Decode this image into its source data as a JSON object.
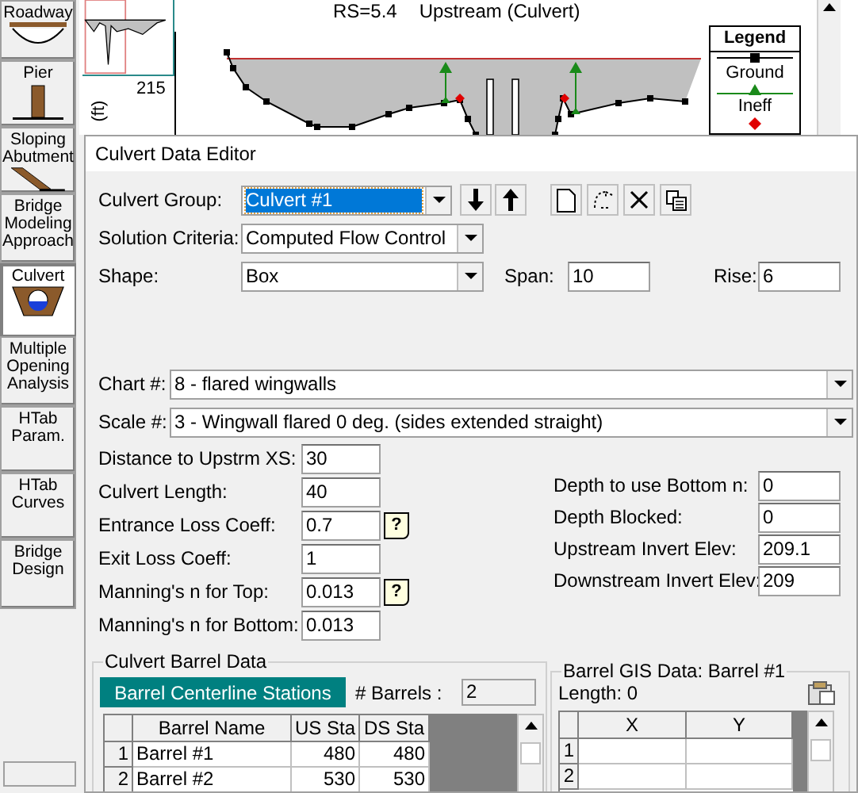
{
  "tool_buttons": [
    {
      "label": "Roadway",
      "kind": "roadway",
      "selected": false
    },
    {
      "label": "Pier",
      "kind": "pier",
      "selected": false
    },
    {
      "label": "Sloping Abutment",
      "kind": "abutment",
      "selected": false
    },
    {
      "label": "Bridge Modeling Approach",
      "kind": "text",
      "selected": false
    },
    {
      "label": "Culvert",
      "kind": "culvert",
      "selected": true
    },
    {
      "label": "Multiple Opening Analysis",
      "kind": "text",
      "selected": false
    },
    {
      "label": "HTab Param.",
      "kind": "text",
      "selected": false
    },
    {
      "label": "HTab Curves",
      "kind": "text",
      "selected": false
    },
    {
      "label": "Bridge Design",
      "kind": "text",
      "selected": false
    }
  ],
  "plot": {
    "station": "RS=5.4",
    "location": "Upstream (Culvert)",
    "ylabel": "(ft)",
    "ytick": "215",
    "legend": {
      "title": "Legend",
      "items": [
        {
          "label": "Ground",
          "kind": "ground"
        },
        {
          "label": "Ineff",
          "kind": "ineff"
        },
        {
          "kind": "bank"
        }
      ]
    }
  },
  "dialog": {
    "title": "Culvert Data Editor",
    "culvert_group": {
      "label": "Culvert Group:",
      "value": "Culvert #1"
    },
    "solution_criteria": {
      "label": "Solution Criteria:",
      "value": "Computed Flow Control"
    },
    "shape": {
      "label": "Shape:",
      "value": "Box"
    },
    "span": {
      "label": "Span:",
      "value": "10"
    },
    "rise": {
      "label": "Rise:",
      "value": "6"
    },
    "chart": {
      "label": "Chart #:",
      "value": "8 - flared wingwalls"
    },
    "scale": {
      "label": "Scale #:",
      "value": "3 - Wingwall flared 0 deg. (sides extended straight)"
    },
    "left_fields": [
      {
        "label": "Distance to Upstrm XS:",
        "value": "30"
      },
      {
        "label": "Culvert Length:",
        "value": "40"
      },
      {
        "label": "Entrance Loss Coeff:",
        "value": "0.7",
        "help": "?"
      },
      {
        "label": "Exit Loss Coeff:",
        "value": "1"
      },
      {
        "label": "Manning's n for Top:",
        "value": "0.013",
        "help": "?"
      },
      {
        "label": "Manning's n for Bottom:",
        "value": "0.013"
      }
    ],
    "right_fields": [
      {
        "label": "Depth to use Bottom n:",
        "value": "0"
      },
      {
        "label": "Depth Blocked:",
        "value": "0"
      },
      {
        "label": "Upstream Invert Elev:",
        "value": "209.1"
      },
      {
        "label": "Downstream Invert Elev:",
        "value": "209"
      }
    ],
    "barrel_data": {
      "title": "Culvert Barrel Data",
      "tab": "Barrel Centerline Stations",
      "count_label": "# Barrels :",
      "count": "2",
      "columns": [
        "Barrel Name",
        "US Sta",
        "DS Sta"
      ],
      "rows": [
        {
          "number": "1",
          "cells": [
            "Barrel #1",
            "480",
            "480"
          ]
        },
        {
          "number": "2",
          "cells": [
            "Barrel #2",
            "530",
            "530"
          ]
        }
      ]
    },
    "gis": {
      "title": "Barrel GIS Data: Barrel #1",
      "length": "Length: 0",
      "columns": [
        "X",
        "Y"
      ],
      "rows": [
        {
          "number": "1"
        },
        {
          "number": "2"
        }
      ]
    }
  }
}
